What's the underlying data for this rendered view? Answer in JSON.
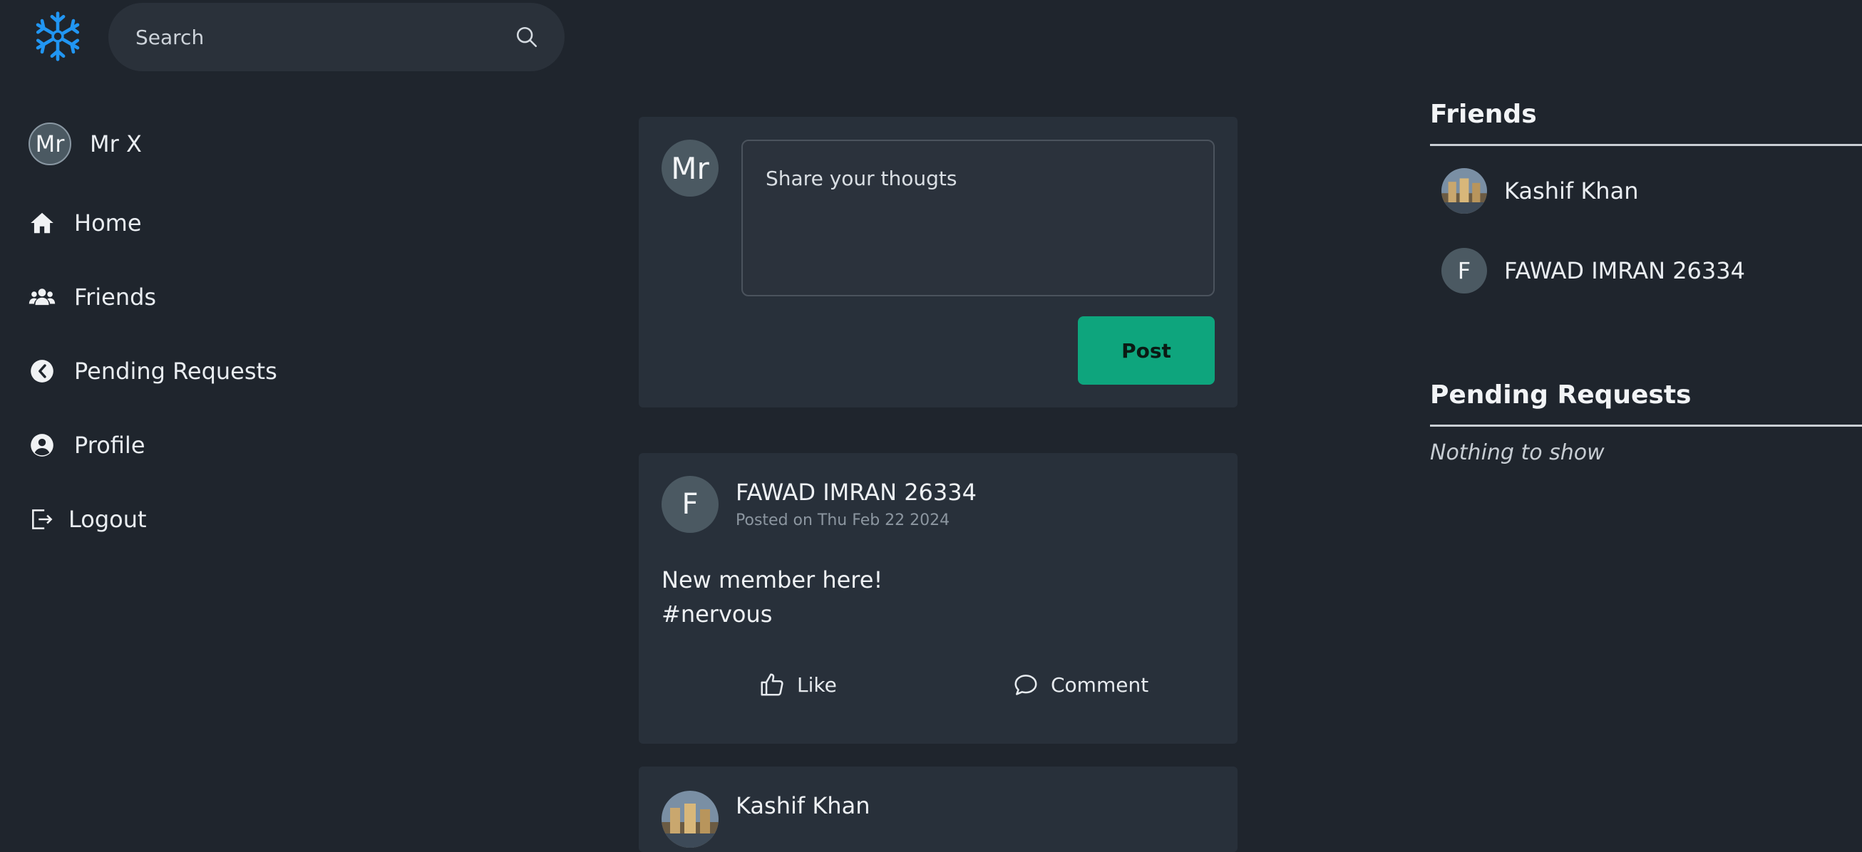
{
  "header": {
    "logo_icon": "snowflake-icon",
    "search_placeholder": "Search"
  },
  "user": {
    "initials": "Mr",
    "name": "Mr X"
  },
  "nav": {
    "home": "Home",
    "friends": "Friends",
    "pending": "Pending Requests",
    "profile": "Profile",
    "logout": "Logout"
  },
  "composer": {
    "avatar_initials": "Mr",
    "placeholder": "Share your thougts",
    "post_label": "Post"
  },
  "posts": [
    {
      "author": "FAWAD IMRAN 26334",
      "initial": "F",
      "date": "Posted on Thu Feb 22 2024",
      "lines": [
        "New member here!",
        "#nervous"
      ],
      "like_label": "Like",
      "comment_label": "Comment"
    },
    {
      "author": "Kashif Khan"
    }
  ],
  "friends": {
    "title": "Friends",
    "items": [
      {
        "name": "Kashif Khan"
      },
      {
        "name": "FAWAD IMRAN 26334",
        "initial": "F"
      }
    ]
  },
  "pending": {
    "title": "Pending Requests",
    "empty_text": "Nothing to show"
  },
  "colors": {
    "background": "#1f252d",
    "card": "#28303a",
    "accent": "#0ea57d",
    "logo": "#1e90ff"
  }
}
